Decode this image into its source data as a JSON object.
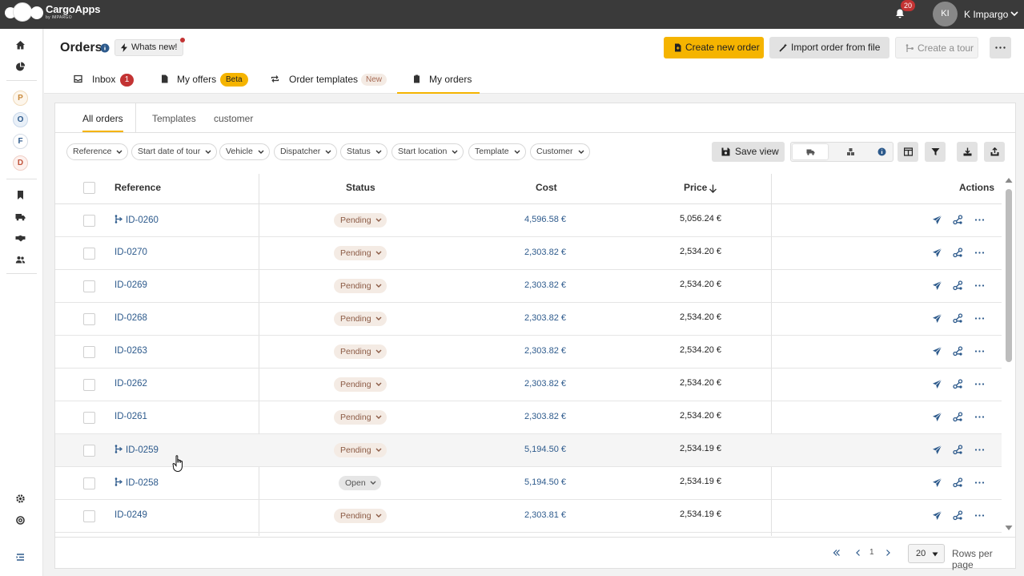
{
  "app": {
    "brand": "CargoApps",
    "brand_sub": "by IMPARGO",
    "notifications": "20",
    "user_initials": "KI",
    "user_name": "K Impargo"
  },
  "sidebar": {
    "letters": [
      "P",
      "O",
      "F",
      "D"
    ]
  },
  "header": {
    "title": "Orders",
    "whats_new": "Whats new!",
    "create_order": "Create new order",
    "import_order": "Import order from file",
    "create_tour": "Create a tour"
  },
  "tabs": [
    {
      "label": "Inbox",
      "badge": "1"
    },
    {
      "label": "My offers",
      "badge": "Beta"
    },
    {
      "label": "Order templates",
      "badge": "New"
    },
    {
      "label": "My orders"
    }
  ],
  "subtabs": [
    "All orders",
    "Templates",
    "customer"
  ],
  "filters": [
    "Reference",
    "Start date of tour",
    "Vehicle",
    "Dispatcher",
    "Status",
    "Start location",
    "Template",
    "Customer"
  ],
  "save_view": "Save view",
  "table": {
    "headers": {
      "reference": "Reference",
      "status": "Status",
      "cost": "Cost",
      "price": "Price",
      "actions": "Actions"
    },
    "rows": [
      {
        "ref": "ID-0260",
        "tour": true,
        "status": "Pending",
        "cost": "4,596.58 €",
        "price": "5,056.24 €"
      },
      {
        "ref": "ID-0270",
        "tour": false,
        "status": "Pending",
        "cost": "2,303.82 €",
        "price": "2,534.20 €"
      },
      {
        "ref": "ID-0269",
        "tour": false,
        "status": "Pending",
        "cost": "2,303.82 €",
        "price": "2,534.20 €"
      },
      {
        "ref": "ID-0268",
        "tour": false,
        "status": "Pending",
        "cost": "2,303.82 €",
        "price": "2,534.20 €"
      },
      {
        "ref": "ID-0263",
        "tour": false,
        "status": "Pending",
        "cost": "2,303.82 €",
        "price": "2,534.20 €"
      },
      {
        "ref": "ID-0262",
        "tour": false,
        "status": "Pending",
        "cost": "2,303.82 €",
        "price": "2,534.20 €"
      },
      {
        "ref": "ID-0261",
        "tour": false,
        "status": "Pending",
        "cost": "2,303.82 €",
        "price": "2,534.20 €"
      },
      {
        "ref": "ID-0259",
        "tour": true,
        "status": "Pending",
        "cost": "5,194.50 €",
        "price": "2,534.19 €"
      },
      {
        "ref": "ID-0258",
        "tour": true,
        "status": "Open",
        "cost": "5,194.50 €",
        "price": "2,534.19 €"
      },
      {
        "ref": "ID-0249",
        "tour": false,
        "status": "Pending",
        "cost": "2,303.81 €",
        "price": "2,534.19 €"
      }
    ]
  },
  "pager": {
    "page": "1",
    "rows_per_page": "20",
    "rows_label": "Rows per page"
  },
  "colors": {
    "accent": "#f5b400",
    "link": "#2d5a8c",
    "topbar": "#3a3a3a",
    "badge_red": "#c33333"
  }
}
